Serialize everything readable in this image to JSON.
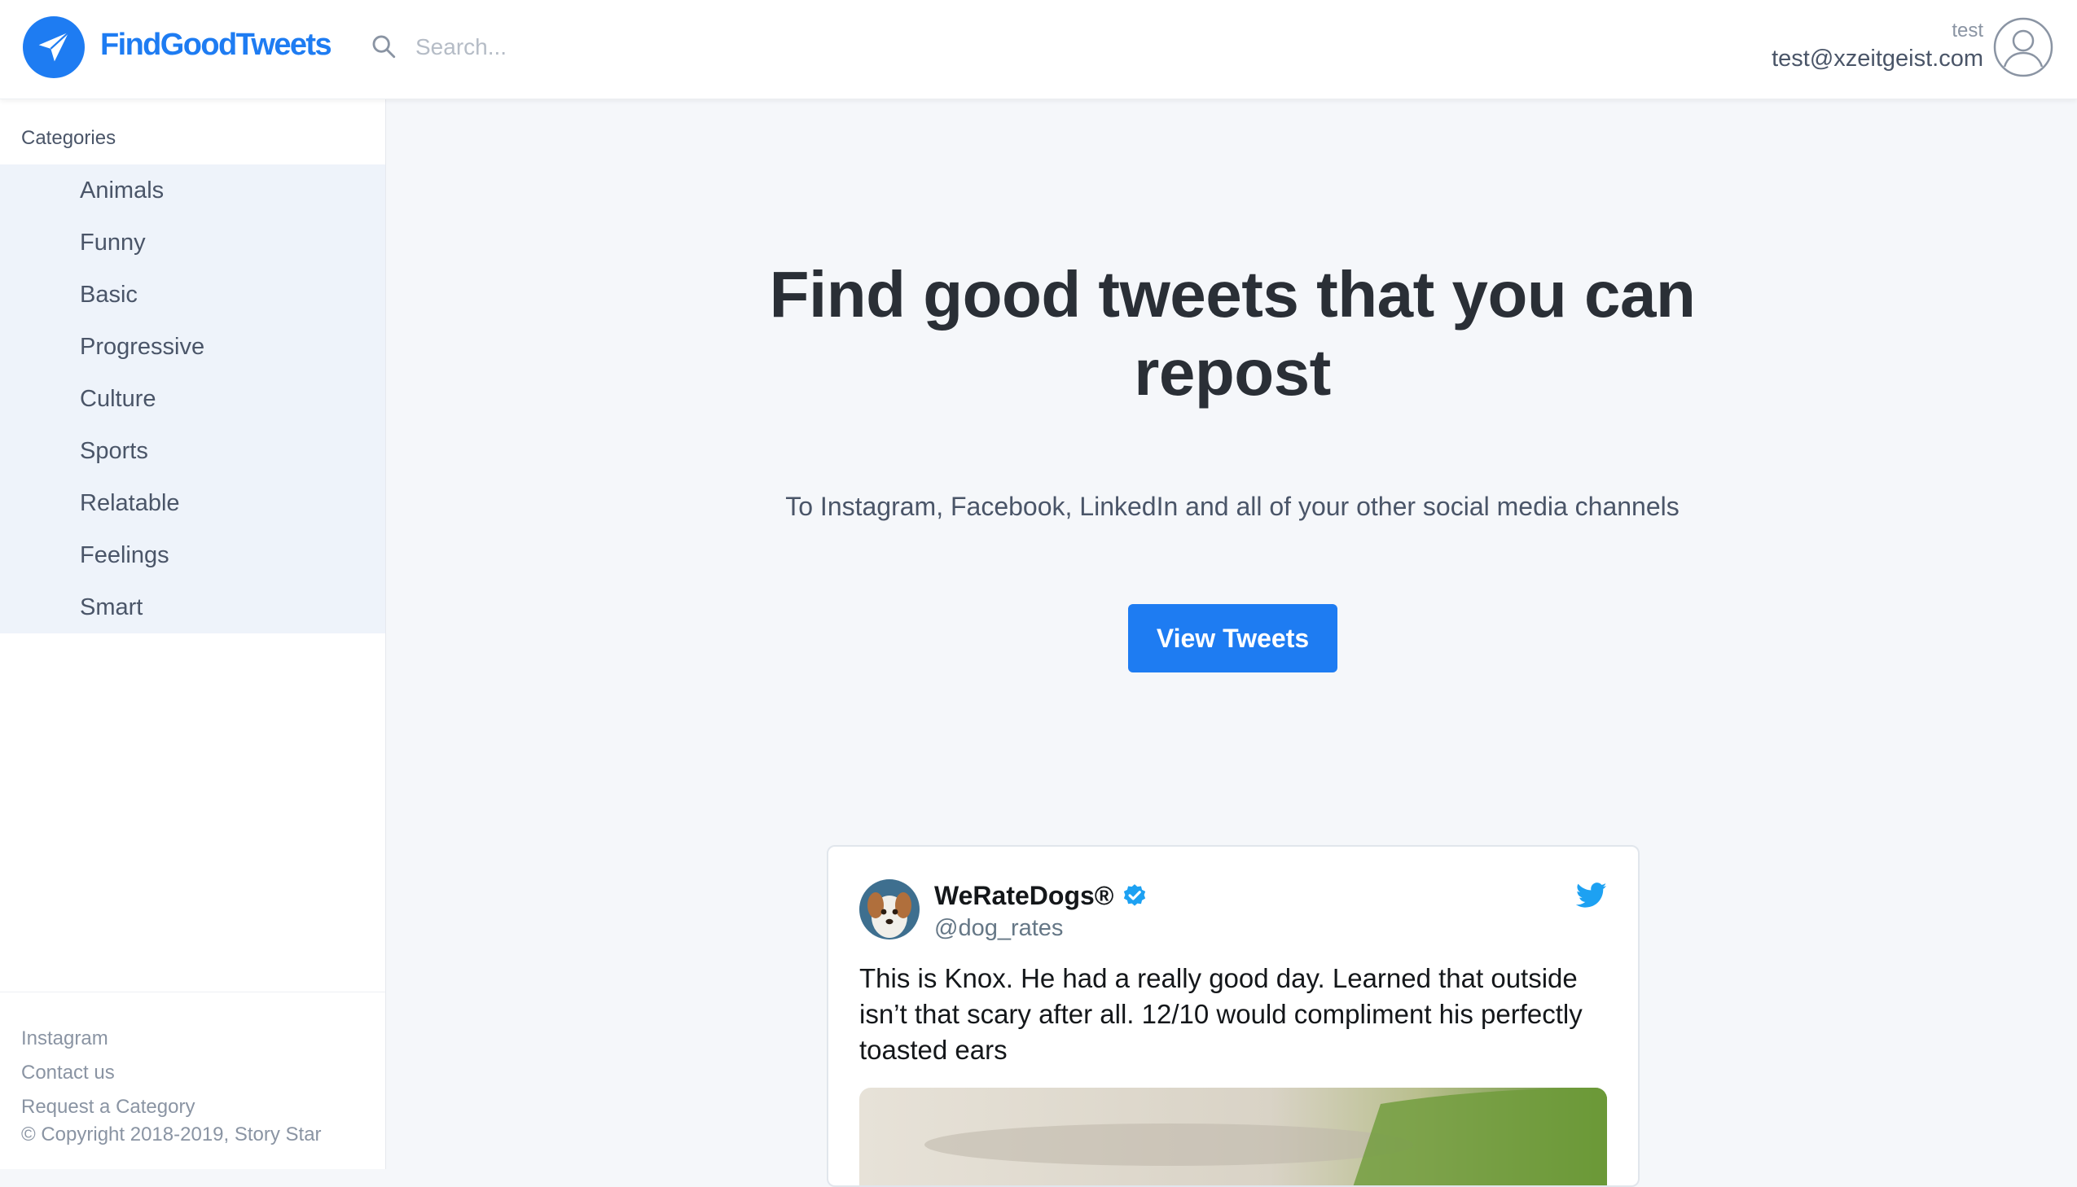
{
  "header": {
    "brand": "FindGoodTweets",
    "search_placeholder": "Search...",
    "user_name": "test",
    "user_email": "test@xzeitgeist.com"
  },
  "sidebar": {
    "title": "Categories",
    "categories": [
      {
        "label": "Animals"
      },
      {
        "label": "Funny"
      },
      {
        "label": "Basic"
      },
      {
        "label": "Progressive"
      },
      {
        "label": "Culture"
      },
      {
        "label": "Sports"
      },
      {
        "label": "Relatable"
      },
      {
        "label": "Feelings"
      },
      {
        "label": "Smart"
      }
    ],
    "footer": {
      "instagram": "Instagram",
      "contact": "Contact us",
      "request": "Request a Category",
      "copyright": "© Copyright 2018-2019, Story Star"
    }
  },
  "hero": {
    "title": "Find good tweets that you can repost",
    "subtitle": "To Instagram, Facebook, LinkedIn and all of your other social media channels",
    "cta_label": "View Tweets"
  },
  "tweet": {
    "author_name": "WeRateDogs®",
    "handle": "@dog_rates",
    "text": "This is Knox. He had a really good day. Learned that outside isn’t that scary after all. 12/10 would compliment his perfectly toasted ears",
    "verified": true,
    "icons": [
      "verified-badge-icon",
      "twitter-bird-icon"
    ]
  },
  "colors": {
    "brand": "#1e7cf2",
    "background": "#f5f7fa",
    "sidebar_highlight": "#eef3fa",
    "twitter_blue": "#1da1f2"
  }
}
